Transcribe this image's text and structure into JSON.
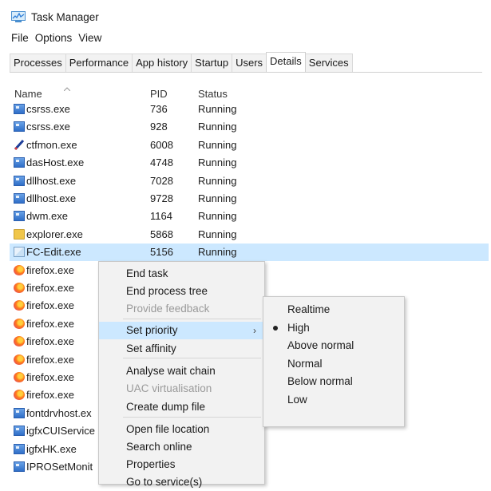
{
  "window": {
    "title": "Task Manager"
  },
  "menu": [
    "File",
    "Options",
    "View"
  ],
  "tabs": [
    "Processes",
    "Performance",
    "App history",
    "Startup",
    "Users",
    "Details",
    "Services"
  ],
  "active_tab": "Details",
  "columns": {
    "name": "Name",
    "pid": "PID",
    "status": "Status"
  },
  "rows": [
    {
      "name": "csrss.exe",
      "pid": "736",
      "status": "Running",
      "icon": "system-process-icon"
    },
    {
      "name": "csrss.exe",
      "pid": "928",
      "status": "Running",
      "icon": "system-process-icon"
    },
    {
      "name": "ctfmon.exe",
      "pid": "6008",
      "status": "Running",
      "icon": "pen-icon"
    },
    {
      "name": "dasHost.exe",
      "pid": "4748",
      "status": "Running",
      "icon": "system-process-icon"
    },
    {
      "name": "dllhost.exe",
      "pid": "7028",
      "status": "Running",
      "icon": "system-process-icon"
    },
    {
      "name": "dllhost.exe",
      "pid": "9728",
      "status": "Running",
      "icon": "system-process-icon"
    },
    {
      "name": "dwm.exe",
      "pid": "1164",
      "status": "Running",
      "icon": "system-process-icon"
    },
    {
      "name": "explorer.exe",
      "pid": "5868",
      "status": "Running",
      "icon": "folder-icon"
    },
    {
      "name": "FC-Edit.exe",
      "pid": "5156",
      "status": "Running",
      "icon": "image-icon"
    },
    {
      "name": "firefox.exe",
      "pid": "",
      "status": "",
      "icon": "firefox-icon"
    },
    {
      "name": "firefox.exe",
      "pid": "",
      "status": "",
      "icon": "firefox-icon"
    },
    {
      "name": "firefox.exe",
      "pid": "",
      "status": "",
      "icon": "firefox-icon"
    },
    {
      "name": "firefox.exe",
      "pid": "",
      "status": "",
      "icon": "firefox-icon"
    },
    {
      "name": "firefox.exe",
      "pid": "",
      "status": "",
      "icon": "firefox-icon"
    },
    {
      "name": "firefox.exe",
      "pid": "",
      "status": "",
      "icon": "firefox-icon"
    },
    {
      "name": "firefox.exe",
      "pid": "",
      "status": "",
      "icon": "firefox-icon"
    },
    {
      "name": "firefox.exe",
      "pid": "",
      "status": "",
      "icon": "firefox-icon"
    },
    {
      "name": "fontdrvhost.ex",
      "pid": "",
      "status": "",
      "icon": "system-process-icon"
    },
    {
      "name": "igfxCUIService",
      "pid": "",
      "status": "",
      "icon": "system-process-icon"
    },
    {
      "name": "igfxHK.exe",
      "pid": "",
      "status": "",
      "icon": "system-process-icon"
    },
    {
      "name": "IPROSetMonit",
      "pid": "",
      "status": "",
      "icon": "system-process-icon"
    }
  ],
  "selected_row_index": 8,
  "context_menu": {
    "items": [
      {
        "label": "End task",
        "disabled": false
      },
      {
        "label": "End process tree",
        "disabled": false
      },
      {
        "label": "Provide feedback",
        "disabled": true
      },
      {
        "label": "Set priority",
        "disabled": false,
        "submenu": true
      },
      {
        "label": "Set affinity",
        "disabled": false
      },
      {
        "label": "Analyse wait chain",
        "disabled": false
      },
      {
        "label": "UAC virtualisation",
        "disabled": true
      },
      {
        "label": "Create dump file",
        "disabled": false
      },
      {
        "label": "Open file location",
        "disabled": false
      },
      {
        "label": "Search online",
        "disabled": false
      },
      {
        "label": "Properties",
        "disabled": false
      },
      {
        "label": "Go to service(s)",
        "disabled": false
      }
    ],
    "highlighted": "Set priority",
    "submenu_arrow": "›"
  },
  "priority_submenu": {
    "items": [
      "Realtime",
      "High",
      "Above normal",
      "Normal",
      "Below normal",
      "Low"
    ],
    "selected": "High"
  },
  "colors": {
    "selection": "#cce8ff",
    "menu_bg": "#f2f2f2",
    "disabled_text": "#9a9a9a"
  }
}
